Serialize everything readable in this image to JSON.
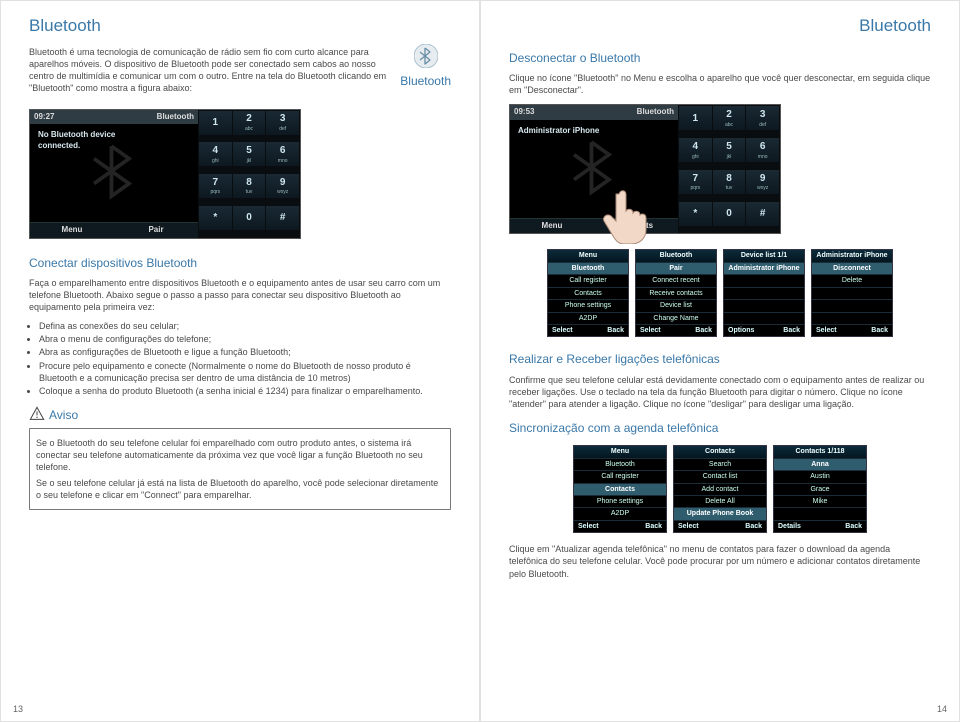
{
  "header_left": "Bluetooth",
  "header_right": "Bluetooth",
  "badge_label": "Bluetooth",
  "intro_para1": "Bluetooth é uma tecnologia de comunicação de rádio sem fio com curto alcance para aparelhos móveis. O dispositivo de Bluetooth pode ser conectado sem cabos ao nosso centro de multimídia e comunicar um com o outro. Entre na tela do Bluetooth clicando em \"Bluetooth\" como mostra a figura abaixo:",
  "mock_a": {
    "time": "09:27",
    "title": "Bluetooth",
    "body_line1": "No Bluetooth device",
    "body_line2": "connected.",
    "soft_left": "Menu",
    "soft_right": "Pair"
  },
  "mock_b": {
    "time": "09:53",
    "title": "Bluetooth",
    "body_line1": "Administrator iPhone",
    "body_line2": "",
    "soft_left": "Menu",
    "soft_right": "Contacts"
  },
  "keypad": [
    {
      "n": "1",
      "a": ""
    },
    {
      "n": "2",
      "a": "abc"
    },
    {
      "n": "3",
      "a": "def"
    },
    {
      "n": "4",
      "a": "ghi"
    },
    {
      "n": "5",
      "a": "jkl"
    },
    {
      "n": "6",
      "a": "mno"
    },
    {
      "n": "7",
      "a": "pqrs"
    },
    {
      "n": "8",
      "a": "tuv"
    },
    {
      "n": "9",
      "a": "wxyz"
    },
    {
      "n": "*",
      "a": ""
    },
    {
      "n": "0",
      "a": ""
    },
    {
      "n": "#",
      "a": ""
    }
  ],
  "conn_title": "Conectar dispositivos Bluetooth",
  "conn_p1": "Faça o emparelhamento entre dispositivos Bluetooth e o equipamento antes de usar seu carro com um telefone Bluetooth. Abaixo segue o passo a passo para conectar seu dispositivo Bluetooth ao equipamento pela primeira vez:",
  "conn_steps": [
    "Defina as conexões do seu celular;",
    "Abra o menu de configurações do telefone;",
    "Abra as configurações de Bluetooth e ligue a função Bluetooth;",
    "Procure pelo equipamento e conecte (Normalmente o nome do Bluetooth de nosso produto é Bluetooth e a comunicação precisa ser dentro de uma distância de 10 metros)",
    "Coloque a senha do produto Bluetooth (a senha inicial é 1234) para finalizar o emparelhamento."
  ],
  "aviso_label": "Aviso",
  "aviso1": "Se o Bluetooth do seu telefone celular foi emparelhado com outro produto antes, o sistema irá conectar seu telefone automaticamente da próxima vez que você ligar a função Bluetooth no seu telefone.",
  "aviso2": "Se o seu telefone celular já está na lista de Bluetooth do aparelho, você pode selecionar diretamente o seu telefone e clicar em \"Connect\" para emparelhar.",
  "disc_title": "Desconectar o Bluetooth",
  "disc_p1": "Clique no ícone \"Bluetooth\" no Menu e escolha o aparelho que você quer desconectar, em seguida clique em \"Desconectar\".",
  "realizar_title": "Realizar e Receber ligações telefônicas",
  "realizar_p1": "Confirme que seu telefone celular está devidamente conectado com o equipamento antes de realizar ou receber ligações. Use o teclado na tela da função Bluetooth para digitar o número. Clique no ícone \"atender\" para atender a ligação. Clique no ícone \"desligar\" para desligar uma ligação.",
  "sync_title": "Sincronização com a agenda telefônica",
  "sync_p1": "Clique em \"Atualizar agenda telefônica\" no menu de contatos para fazer o download da agenda telefônica do seu telefone celular. Você pode procurar por um número e adicionar contatos diretamente pelo Bluetooth.",
  "menus_top": [
    {
      "title": "Menu",
      "rows": [
        "Bluetooth",
        "Call register",
        "Contacts",
        "Phone settings",
        "A2DP"
      ],
      "hi": 0,
      "foot_l": "Select",
      "foot_r": "Back"
    },
    {
      "title": "Bluetooth",
      "rows": [
        "Pair",
        "Connect recent",
        "Receive contacts",
        "Device list",
        "Change Name"
      ],
      "hi": 0,
      "foot_l": "Select",
      "foot_r": "Back"
    },
    {
      "title": "Device list 1/1",
      "rows": [
        "Administrator iPhone",
        "",
        "",
        "",
        ""
      ],
      "hi": 0,
      "foot_l": "Options",
      "foot_r": "Back"
    },
    {
      "title": "Administrator iPhone",
      "rows": [
        "Disconnect",
        "Delete",
        "",
        "",
        ""
      ],
      "hi": 0,
      "foot_l": "Select",
      "foot_r": "Back"
    }
  ],
  "menus_bottom": [
    {
      "title": "Menu",
      "rows": [
        "Bluetooth",
        "Call register",
        "Contacts",
        "Phone settings",
        "A2DP"
      ],
      "hi": 2,
      "foot_l": "Select",
      "foot_r": "Back"
    },
    {
      "title": "Contacts",
      "rows": [
        "Search",
        "Contact list",
        "Add contact",
        "Delete All",
        "Update Phone Book"
      ],
      "hi": 4,
      "foot_l": "Select",
      "foot_r": "Back"
    },
    {
      "title": "Contacts 1/118",
      "rows": [
        "Anna",
        "Austin",
        "Grace",
        "Mike",
        ""
      ],
      "hi": 0,
      "foot_l": "Details",
      "foot_r": "Back"
    }
  ],
  "page_left_num": "13",
  "page_right_num": "14"
}
